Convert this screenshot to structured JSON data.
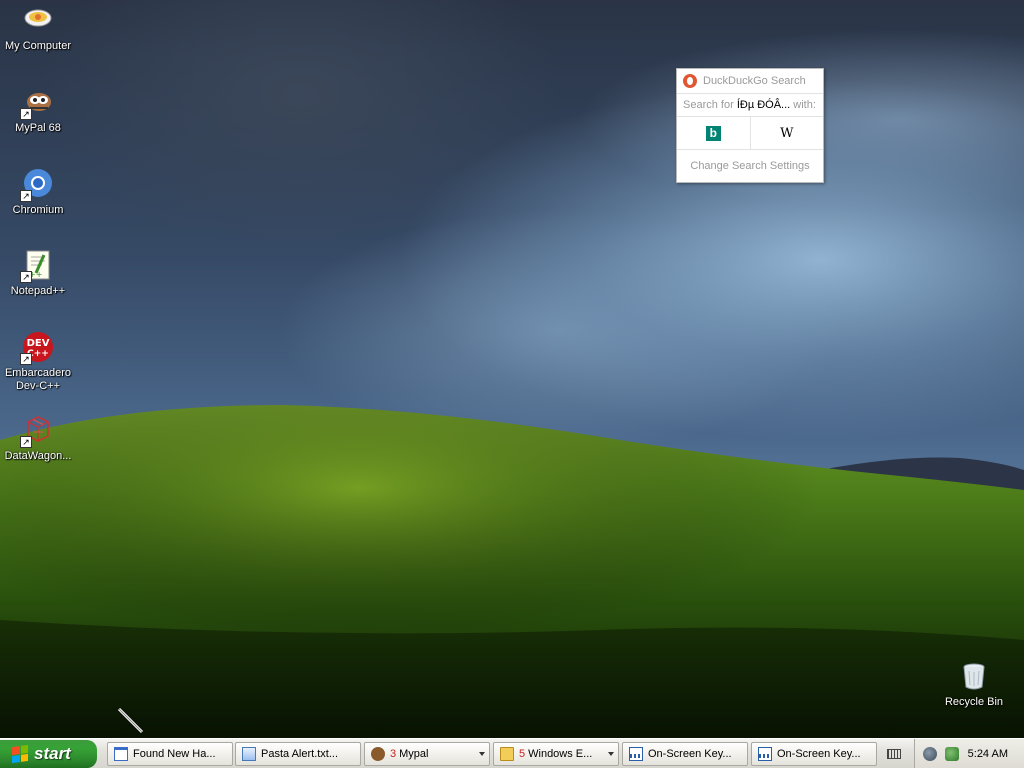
{
  "desktop": {
    "icons": [
      {
        "label": "My Computer"
      },
      {
        "label": "MyPal 68"
      },
      {
        "label": "Chromium"
      },
      {
        "label": "Notepad++"
      },
      {
        "label": "Embarcadero\nDev-C++"
      },
      {
        "label": "DataWagon..."
      },
      {
        "label": "Recycle Bin"
      }
    ]
  },
  "ddg_popup": {
    "title": "DuckDuckGo Search",
    "search_prefix": "Search for",
    "query": "ÍÐµ ÐÓÂ...",
    "search_suffix": "with:",
    "engines": [
      {
        "name": "bing-icon",
        "glyph": "b"
      },
      {
        "name": "wikipedia-icon",
        "glyph": "W"
      }
    ],
    "settings_label": "Change Search Settings"
  },
  "taskbar": {
    "start_label": "start",
    "buttons": [
      {
        "label": "Found New Ha..."
      },
      {
        "label": "Pasta Alert.txt..."
      },
      {
        "count": "3",
        "label": "Mypal"
      },
      {
        "count": "5",
        "label": "Windows E..."
      },
      {
        "label": "On-Screen Key..."
      },
      {
        "label": "On-Screen Key..."
      }
    ],
    "clock": "5:24 AM"
  },
  "colors": {
    "start_green": "#36a336",
    "ddg_orange": "#de5833",
    "bing_teal": "#008373"
  }
}
